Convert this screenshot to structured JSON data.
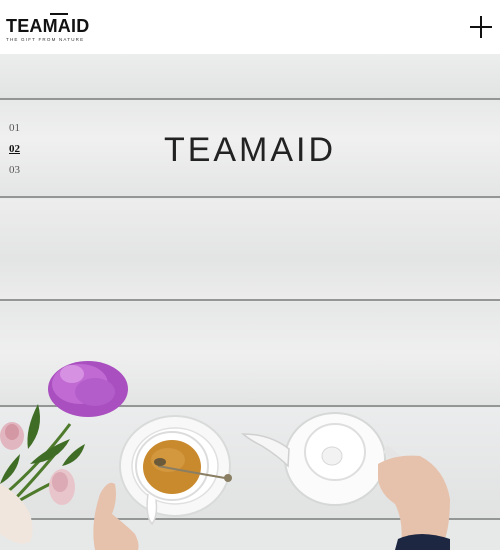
{
  "header": {
    "logo_text": "TEAMAID",
    "logo_tagline": "THE GIFT FROM NATURE",
    "menu_icon": "plus-icon"
  },
  "hero": {
    "title": "TEAMAID",
    "slides": [
      "01",
      "02",
      "03"
    ],
    "active_slide": "02"
  },
  "colors": {
    "wood": "#e9eaea",
    "text": "#222222",
    "peony": "#b85fc9"
  }
}
